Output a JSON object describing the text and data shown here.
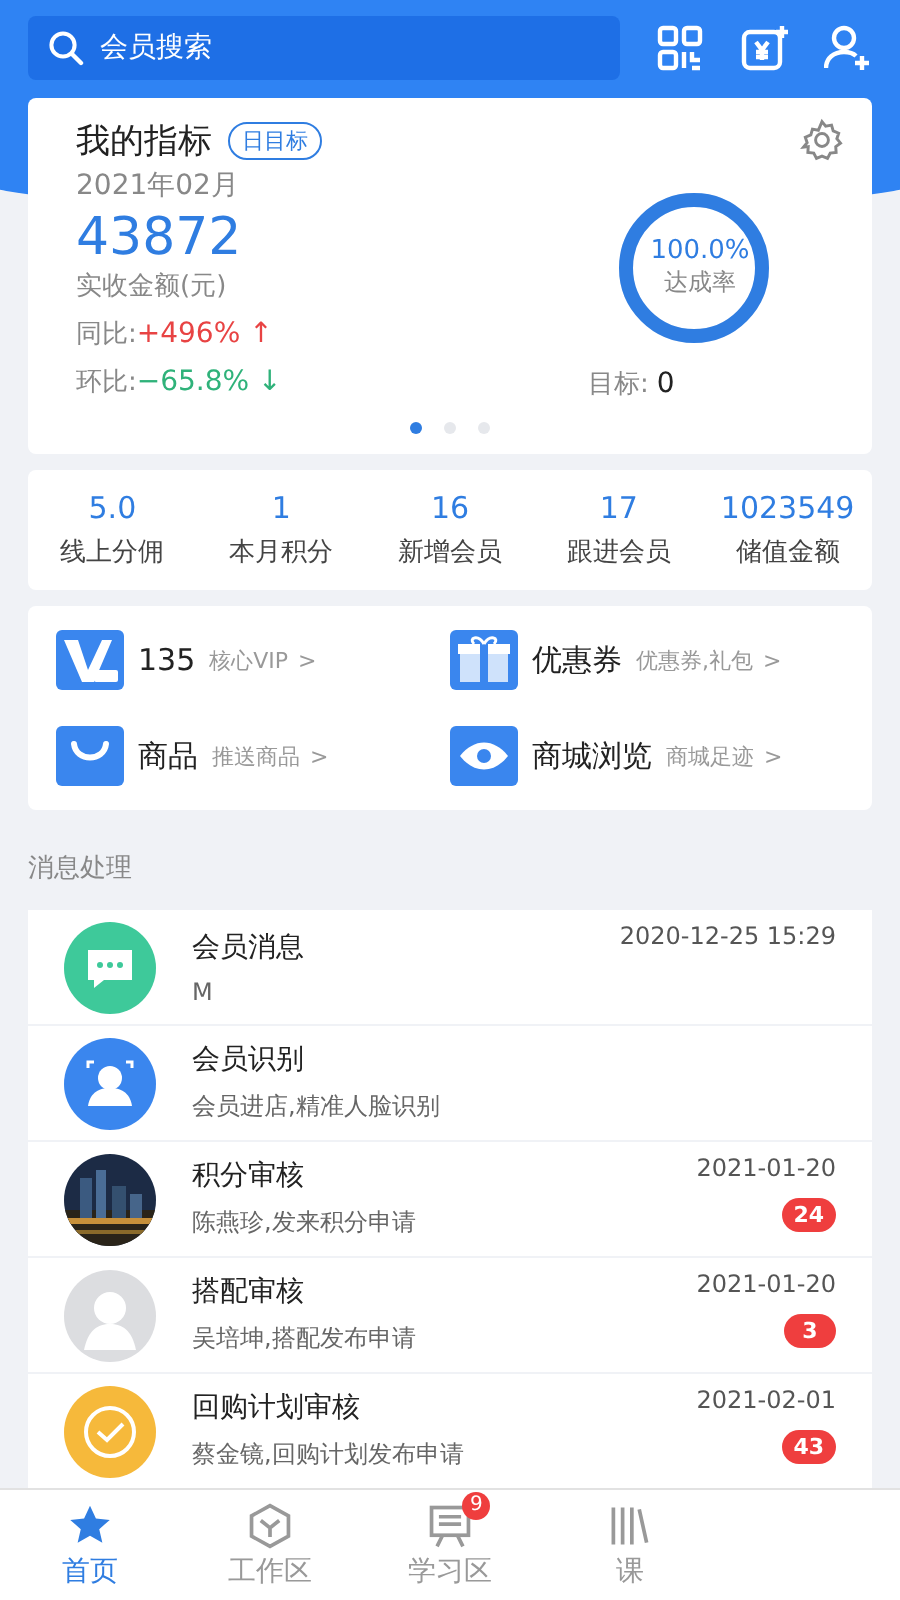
{
  "search": {
    "placeholder": "会员搜索"
  },
  "indicator": {
    "title": "我的指标",
    "tag": "日目标",
    "month": "2021年02月",
    "amount": "43872",
    "amount_label": "实收金额(元)",
    "yoy_label": "同比:",
    "yoy": "+496%",
    "yoy_arrow": "↑",
    "mom_label": "环比:",
    "mom": "−65.8%",
    "mom_arrow": "↓",
    "rate": "100.0%",
    "rate_label": "达成率",
    "level": 1,
    "target_label": "目标:",
    "target": "0",
    "pages": [
      {
        "selected": true
      },
      {
        "selected": false
      },
      {
        "selected": false
      }
    ]
  },
  "stats": [
    {
      "value": "5.0",
      "label": "线上分佣"
    },
    {
      "value": "1",
      "label": "本月积分"
    },
    {
      "value": "16",
      "label": "新增会员"
    },
    {
      "value": "17",
      "label": "跟进会员"
    },
    {
      "value": "1023549",
      "label": "储值金额"
    }
  ],
  "shortcuts": [
    {
      "kind": "vip",
      "title": "135",
      "sub": "核心VIP",
      "chevron": ">"
    },
    {
      "kind": "gift",
      "title": "优惠券",
      "sub": "优惠券,礼包",
      "chevron": ">"
    },
    {
      "kind": "bag",
      "title": "商品",
      "sub": "推送商品",
      "chevron": ">"
    },
    {
      "kind": "eye",
      "title": "商城浏览",
      "sub": "商城足迹",
      "chevron": ">"
    }
  ],
  "section_title": "消息处理",
  "messages": [
    {
      "kind": "chat",
      "title": "会员消息",
      "sub": "M",
      "time": "2020-12-25 15:29"
    },
    {
      "kind": "face",
      "title": "会员识别",
      "sub": "会员进店,精准人脸识别"
    },
    {
      "kind": "picture",
      "title": "积分审核",
      "sub": "陈燕珍,发来积分申请",
      "time": "2021-01-20",
      "count": "24"
    },
    {
      "kind": "avatar",
      "title": "搭配审核",
      "sub": "吴培坤,搭配发布申请",
      "time": "2021-01-20",
      "count": "3"
    },
    {
      "kind": "check",
      "title": "回购计划审核",
      "sub": "蔡金镜,回购计划发布申请",
      "time": "2021-02-01",
      "count": "43"
    }
  ],
  "tabs": [
    {
      "kind": "home",
      "label": "首页",
      "selected": true
    },
    {
      "kind": "work",
      "label": "工作区",
      "selected": false
    },
    {
      "kind": "study",
      "label": "学习区",
      "selected": false,
      "badge": "9"
    },
    {
      "kind": "course",
      "label": "课",
      "selected": false
    }
  ]
}
